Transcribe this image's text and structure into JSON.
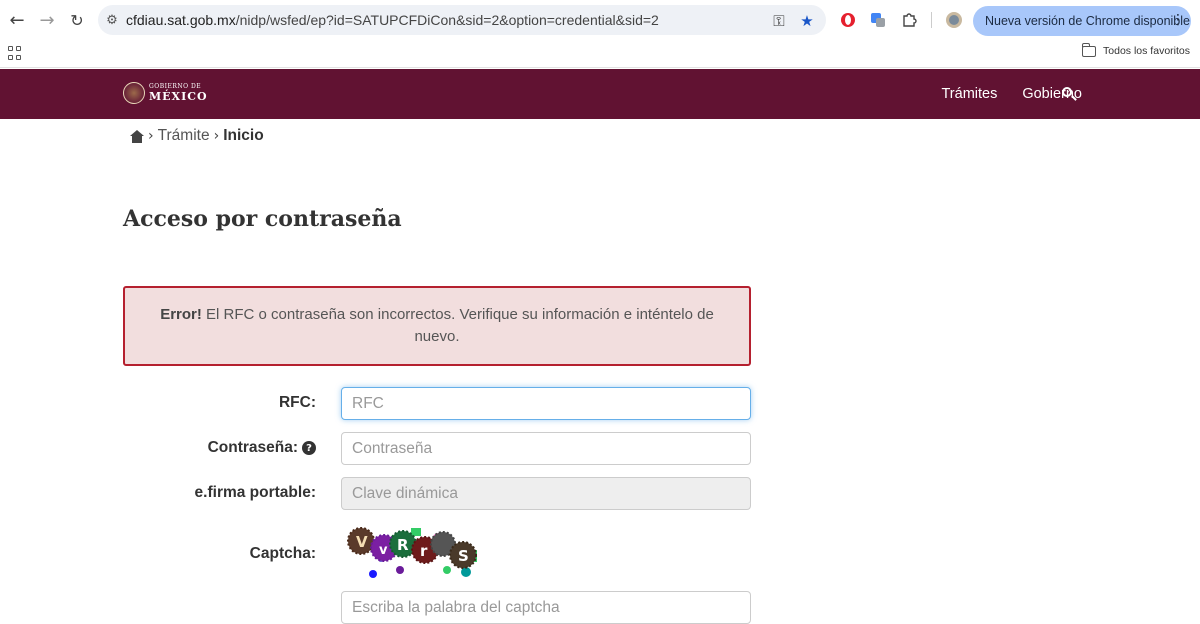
{
  "browser": {
    "url_host": "cfdiau.sat.gob.mx",
    "url_path": "/nidp/wsfed/ep?id=SATUPCFDiCon&sid=2&option=credential&sid=2",
    "update_label": "Nueva versión de Chrome disponible",
    "bookmarks_label": "Todos los favoritos"
  },
  "header": {
    "logo_top": "GOBIERNO DE",
    "logo_bottom": "MÉXICO",
    "nav": [
      "Trámites",
      "Gobierno"
    ],
    "bg_color": "#611232"
  },
  "breadcrumb": {
    "items": [
      "Trámite",
      "Inicio"
    ]
  },
  "page_title": "Acceso por contraseña",
  "alert": {
    "strong": "Error!",
    "message": " El RFC o contraseña son incorrectos. Verifique su información e inténtelo de nuevo."
  },
  "form": {
    "rfc_label": "RFC:",
    "rfc_placeholder": "RFC",
    "password_label": "Contraseña:",
    "password_placeholder": "Contraseña",
    "efirma_label": "e.firma portable:",
    "efirma_placeholder": "Clave dinámica",
    "captcha_label": "Captcha:",
    "captcha_letters": [
      "V",
      "v",
      "R",
      "r",
      "S"
    ],
    "captcha_placeholder": "Escriba la palabra del captcha"
  }
}
